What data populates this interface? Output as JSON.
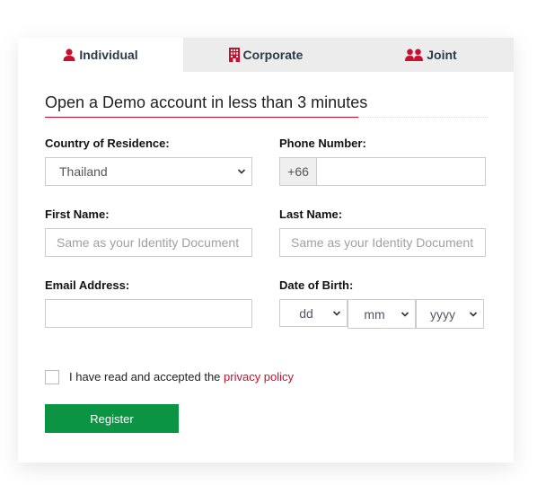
{
  "tabs": [
    {
      "label": "Individual",
      "icon": "user-icon",
      "active": true
    },
    {
      "label": "Corporate",
      "icon": "building-icon",
      "active": false
    },
    {
      "label": "Joint",
      "icon": "users-icon",
      "active": false
    }
  ],
  "form": {
    "heading": "Open a Demo account in less than 3 minutes",
    "country": {
      "label": "Country of Residence:",
      "value": "Thailand"
    },
    "phone": {
      "label": "Phone Number:",
      "prefix": "+66",
      "value": ""
    },
    "first_name": {
      "label": "First Name:",
      "placeholder": "Same as your Identity Document",
      "value": ""
    },
    "last_name": {
      "label": "Last Name:",
      "placeholder": "Same as your Identity Document",
      "value": ""
    },
    "email": {
      "label": "Email Address:",
      "value": ""
    },
    "dob": {
      "label": "Date of Birth:",
      "day": "dd",
      "month": "mm",
      "year": "yyyy"
    },
    "consent": {
      "text": "I have read and accepted the ",
      "link": "privacy policy",
      "checked": false
    },
    "register_label": "Register"
  },
  "colors": {
    "accent": "#c8102e",
    "button": "#0b9444",
    "tab_inactive_bg": "#ececec"
  }
}
